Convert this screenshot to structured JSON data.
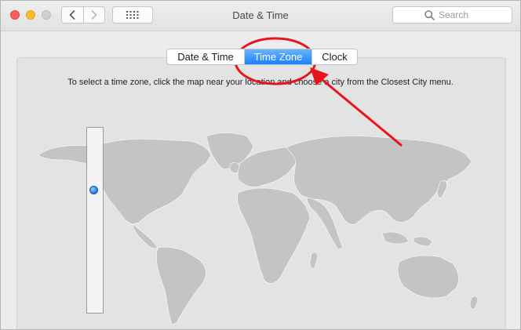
{
  "window": {
    "title": "Date & Time"
  },
  "toolbar": {
    "back_icon": "chevron-left-icon",
    "forward_icon": "chevron-right-icon",
    "show_all_icon": "grid-icon"
  },
  "search": {
    "placeholder": "Search",
    "value": ""
  },
  "tabs": [
    {
      "label": "Date & Time",
      "selected": false
    },
    {
      "label": "Time Zone",
      "selected": true
    },
    {
      "label": "Clock",
      "selected": false
    }
  ],
  "time_zone": {
    "instruction": "To select a time zone, click the map near your location and choose a city from the Closest City menu."
  },
  "colors": {
    "accent": "#1a82fb",
    "annotation": "#e8141b",
    "map_land": "#c4c4c4"
  }
}
